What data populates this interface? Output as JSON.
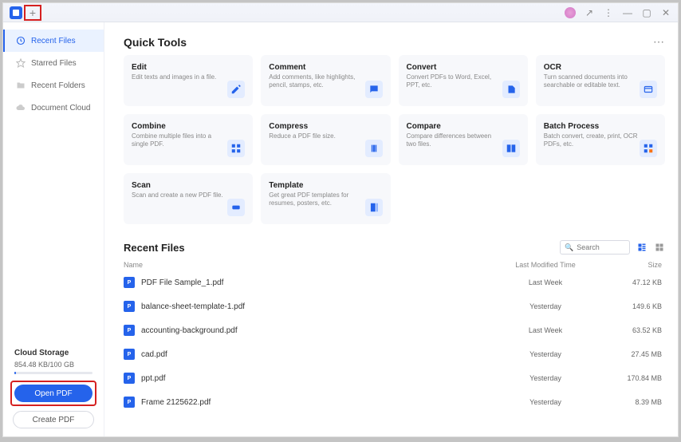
{
  "titlebar": {
    "plus": "+",
    "share": "↗",
    "menu": "⋮",
    "min": "—",
    "max": "▢",
    "close": "✕"
  },
  "sidebar": {
    "items": [
      {
        "label": "Recent Files"
      },
      {
        "label": "Starred Files"
      },
      {
        "label": "Recent Folders"
      },
      {
        "label": "Document Cloud"
      }
    ]
  },
  "cloud": {
    "title": "Cloud Storage",
    "value": "854.48 KB/100 GB"
  },
  "buttons": {
    "open": "Open PDF",
    "create": "Create PDF"
  },
  "sections": {
    "tools": "Quick Tools",
    "recent": "Recent Files"
  },
  "tools": [
    {
      "title": "Edit",
      "desc": "Edit texts and images in a file."
    },
    {
      "title": "Comment",
      "desc": "Add comments, like highlights, pencil, stamps, etc."
    },
    {
      "title": "Convert",
      "desc": "Convert PDFs to Word, Excel, PPT, etc."
    },
    {
      "title": "OCR",
      "desc": "Turn scanned documents into searchable or editable text."
    },
    {
      "title": "Combine",
      "desc": "Combine multiple files into a single PDF."
    },
    {
      "title": "Compress",
      "desc": "Reduce a PDF file size."
    },
    {
      "title": "Compare",
      "desc": "Compare differences between two files."
    },
    {
      "title": "Batch Process",
      "desc": "Batch convert, create, print, OCR PDFs, etc."
    },
    {
      "title": "Scan",
      "desc": "Scan and create a new PDF file."
    },
    {
      "title": "Template",
      "desc": "Get great PDF templates for resumes, posters, etc."
    }
  ],
  "search": {
    "placeholder": "Search"
  },
  "columns": {
    "name": "Name",
    "mod": "Last Modified Time",
    "size": "Size"
  },
  "files": [
    {
      "name": "PDF File Sample_1.pdf",
      "mod": "Last Week",
      "size": "47.12 KB"
    },
    {
      "name": "balance-sheet-template-1.pdf",
      "mod": "Yesterday",
      "size": "149.6 KB"
    },
    {
      "name": "accounting-background.pdf",
      "mod": "Last Week",
      "size": "63.52 KB"
    },
    {
      "name": "cad.pdf",
      "mod": "Yesterday",
      "size": "27.45 MB"
    },
    {
      "name": "ppt.pdf",
      "mod": "Yesterday",
      "size": "170.84 MB"
    },
    {
      "name": "Frame 2125622.pdf",
      "mod": "Yesterday",
      "size": "8.39 MB"
    }
  ]
}
